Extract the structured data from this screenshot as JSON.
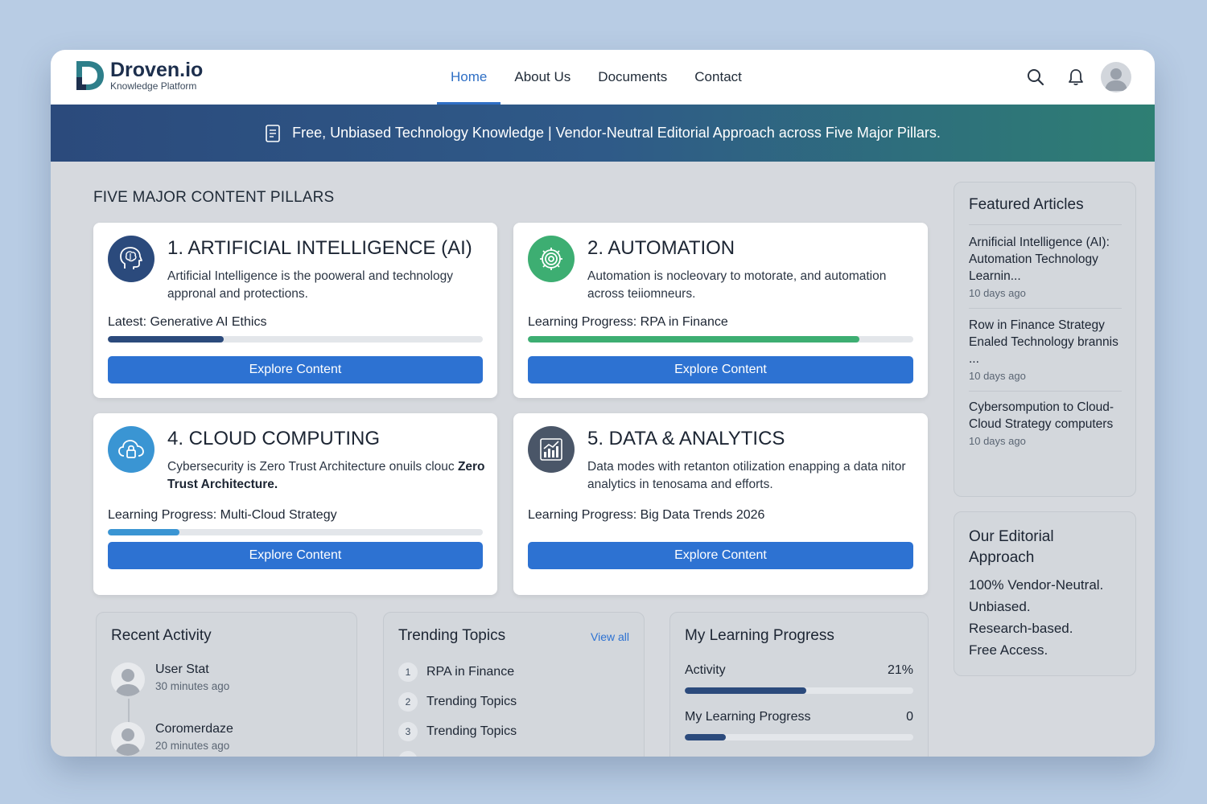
{
  "brand": {
    "name": "Droven.io",
    "tagline": "Knowledge Platform",
    "primary_color": "#2d72d2",
    "dark_color": "#1d2f4d"
  },
  "nav": {
    "items": [
      {
        "label": "Home",
        "active": true
      },
      {
        "label": "About Us",
        "active": false
      },
      {
        "label": "Documents",
        "active": false
      },
      {
        "label": "Contact",
        "active": false
      }
    ],
    "icons": [
      "search-icon",
      "bell-icon",
      "user-avatar"
    ]
  },
  "banner": {
    "icon": "document-icon",
    "text": "Free, Unbiased Technology Knowledge | Vendor-Neutral Editorial Approach across Five Major Pillars."
  },
  "pillars": {
    "section_title": "FIVE MAJOR CONTENT PILLARS",
    "cards": [
      {
        "title": "1. ARTIFICIAL INTELLIGENCE (AI)",
        "description": "Artificial Intelligence is the pooweral and technology appronal and protections.",
        "progress_prefix": "Latest: ",
        "progress_topic": "Generative AI Ethics",
        "progress": 0.31,
        "bar_color": "#2b4a7c",
        "icon": "brain-head-icon",
        "icon_color": "#2b4a7c",
        "button_label": "Explore Content"
      },
      {
        "title": "2. AUTOMATION",
        "description": "Automation is nocleovary to motorate, and automation across teiiomneurs.",
        "progress_prefix": "Learning Progress: ",
        "progress_topic": "RPA in Finance",
        "progress": 0.86,
        "bar_color": "#3dae72",
        "icon": "gear-icon",
        "icon_color": "#3dae72",
        "button_label": "Explore Content"
      },
      {
        "title": "4. CLOUD COMPUTING",
        "description_prefix": "Cybersecurity is Zero Trust Architecture onuils clouc ",
        "description_emphasis": "Zero Trust Architecture.",
        "progress_prefix": "Learning Progress: ",
        "progress_topic": "Multi-Cloud Strategy",
        "progress": 0.19,
        "bar_color": "#3a95d3",
        "icon": "cloud-lock-icon",
        "icon_color": "#3a95d3",
        "button_label": "Explore Content"
      },
      {
        "title": "5. DATA & ANALYTICS",
        "description": "Data modes with retanton otilization enapping a data nitor analytics in tenosama and efforts.",
        "progress_prefix": "Learning Progress: ",
        "progress_topic": "Big Data Trends 2026",
        "icon": "analytics-chart-icon",
        "icon_color": "#4a5668",
        "button_label": "Explore Content"
      }
    ]
  },
  "featured": {
    "title": "Featured Articles",
    "articles": [
      {
        "title": "Arnificial Intelligence (AI): Automation Technology Learnin...",
        "time": "10 days ago"
      },
      {
        "title": "Row in Finance Strategy Enaled Technology brannis ...",
        "time": "10 days ago"
      },
      {
        "title": "Cybersompution to Cloud-Cloud  Strategy computers",
        "time": "10 days ago"
      }
    ]
  },
  "editorial": {
    "title": "Our Editorial Approach",
    "lines": [
      "100% Vendor-Neutral.",
      "Unbiased.",
      "Research-based.",
      "Free Access."
    ]
  },
  "recent_activity": {
    "title": "Recent Activity",
    "items": [
      {
        "name": "User Stat",
        "time": "30 minutes ago"
      },
      {
        "name": "Coromerdaze",
        "time": "20 minutes ago"
      }
    ]
  },
  "trending": {
    "title": "Trending Topics",
    "view_all": "View all",
    "topics": [
      {
        "num": "1",
        "label": "RPA in Finance"
      },
      {
        "num": "2",
        "label": "Trending Topics"
      },
      {
        "num": "3",
        "label": "Trending Topics"
      }
    ]
  },
  "learning_progress": {
    "title": "My Learning Progress",
    "rows": [
      {
        "label": "Activity",
        "value": "21%",
        "progress": 0.53
      },
      {
        "label": "My Learning Progress",
        "value": "0",
        "progress": 0.18
      }
    ],
    "bar_color": "#2b4a7c"
  }
}
